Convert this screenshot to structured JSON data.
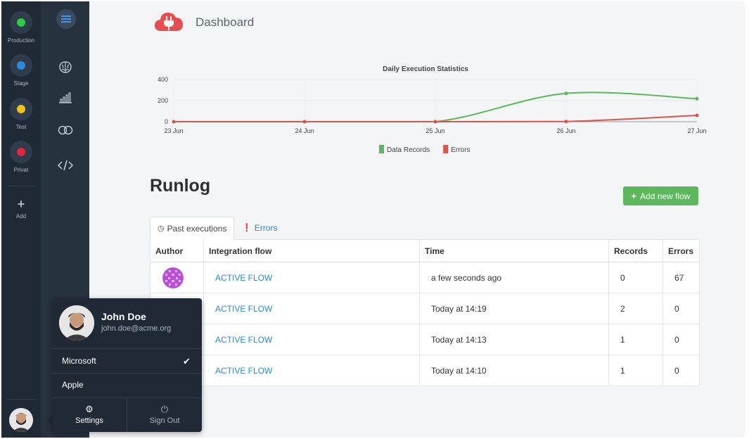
{
  "environments": [
    {
      "label": "Production",
      "color": "#2ecc40"
    },
    {
      "label": "Stage",
      "color": "#2e86de"
    },
    {
      "label": "Test",
      "color": "#f1c40f"
    },
    {
      "label": "Privat",
      "color": "#e8233f"
    }
  ],
  "add_label": "Add",
  "nav_icons": [
    "menu-icon",
    "brain-icon",
    "bar-chart-icon",
    "rings-icon",
    "code-icon"
  ],
  "header": {
    "title": "Dashboard",
    "logo_color": "#e84c4c"
  },
  "chart_data": {
    "type": "line",
    "title": "Daily Execution Statistics",
    "categories": [
      "23 Jun",
      "24 Jun",
      "25 Jun",
      "26 Jun",
      "27 Jun"
    ],
    "yticks": [
      0,
      200,
      400
    ],
    "ylim": [
      0,
      400
    ],
    "series": [
      {
        "name": "Data Records",
        "color": "#5cb85c",
        "values": [
          0,
          0,
          0,
          268,
          218
        ]
      },
      {
        "name": "Errors",
        "color": "#d9534f",
        "values": [
          0,
          0,
          0,
          2,
          60
        ]
      }
    ],
    "legend": "bottom"
  },
  "runlog": {
    "title": "Runlog",
    "add_button": "Add new flow",
    "tabs": [
      {
        "label": "Past executions"
      },
      {
        "label": "Errors"
      }
    ],
    "columns": [
      "Author",
      "Integration flow",
      "Time",
      "Records",
      "Errors"
    ],
    "rows": [
      {
        "flow": "ACTIVE FLOW",
        "time": "a few seconds ago",
        "records": "0",
        "errors": "67"
      },
      {
        "flow": "ACTIVE FLOW",
        "time": "Today at 14:19",
        "records": "2",
        "errors": "0"
      },
      {
        "flow": "ACTIVE FLOW",
        "time": "Today at 14:13",
        "records": "1",
        "errors": "0"
      },
      {
        "flow": "ACTIVE FLOW",
        "time": "Today at 14:10",
        "records": "1",
        "errors": "0"
      }
    ]
  },
  "user": {
    "name": "John Doe",
    "email": "john.doe@acme.org",
    "orgs": [
      {
        "name": "Microsoft",
        "selected": true
      },
      {
        "name": "Apple",
        "selected": false
      }
    ],
    "settings_label": "Settings",
    "signout_label": "Sign Out"
  }
}
